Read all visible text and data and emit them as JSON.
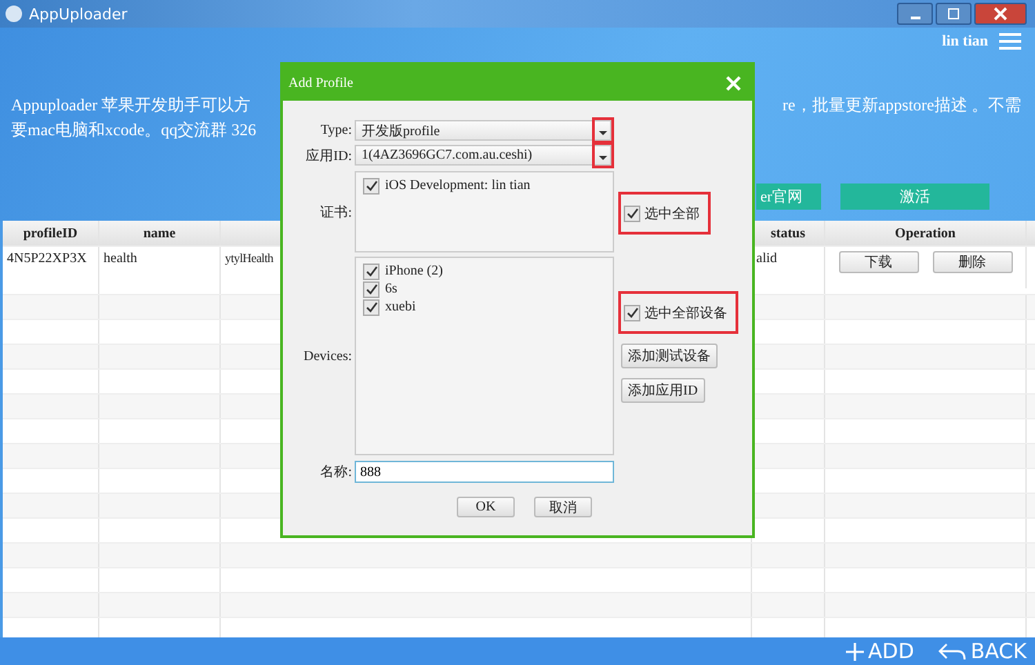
{
  "window": {
    "title": "AppUploader"
  },
  "header": {
    "user": "lin tian",
    "description_line_1_left": "Appuploader 苹果开发助手可以方",
    "description_line_1_right": "re，批量更新appstore描述 。不需",
    "description_line_2": "要mac电脑和xcode。qq交流群 326",
    "buttons": [
      "er官网",
      "激活"
    ]
  },
  "table": {
    "columns": [
      "profileID",
      "name",
      "status",
      "Operation"
    ],
    "rows": [
      {
        "profileID": "4N5P22XP3X",
        "name": "health",
        "column_3": "ytylHealth",
        "status": "alid",
        "actions": [
          "下载",
          "删除"
        ]
      }
    ]
  },
  "bottom_bar": {
    "add": "ADD",
    "back": "BACK"
  },
  "dialog": {
    "title": "Add Profile",
    "type": {
      "label": "Type:",
      "value": "开发版profile",
      "highlighted": true
    },
    "app_id": {
      "label": "应用ID:",
      "value": "1(4AZ3696GC7.com.au.ceshi)",
      "highlighted": true
    },
    "certificates": {
      "label": "证书:",
      "items": [
        {
          "label": "iOS Development: lin tian",
          "checked": true
        }
      ],
      "select_all": {
        "label": "选中全部",
        "checked": true,
        "highlighted": true
      }
    },
    "devices": {
      "label": "Devices:",
      "items": [
        {
          "label": "iPhone (2)",
          "checked": true
        },
        {
          "label": "6s",
          "checked": true
        },
        {
          "label": "xuebi",
          "checked": true
        }
      ],
      "select_all": {
        "label": "选中全部设备",
        "checked": true,
        "highlighted": true
      },
      "buttons": [
        "添加测试设备",
        "添加应用ID"
      ]
    },
    "name": {
      "label": "名称:",
      "value": "888"
    },
    "ok": "OK",
    "cancel": "取消"
  }
}
